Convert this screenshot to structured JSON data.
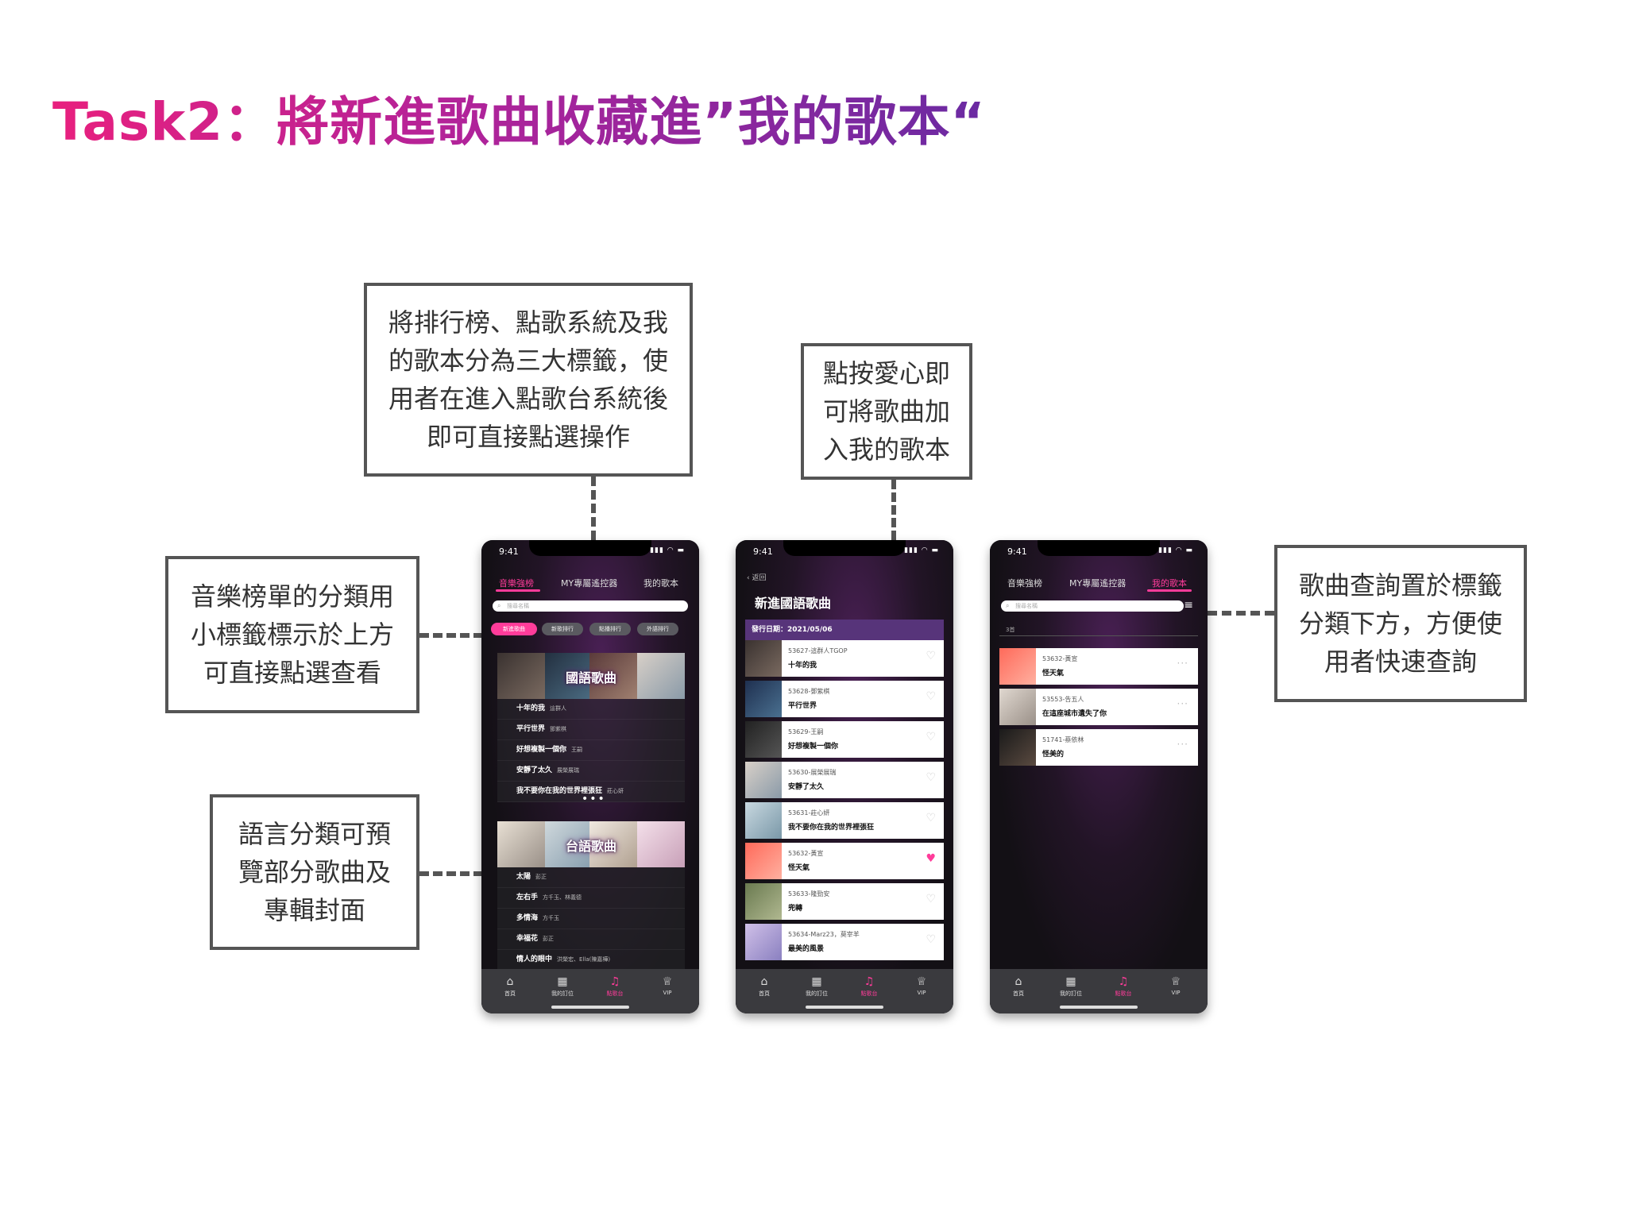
{
  "title": "Task2：將新進歌曲收藏進”我的歌本“",
  "callouts": {
    "tabs": [
      "將排行榜、點歌系統及我",
      "的歌本分為三大標籤，使",
      "用者在進入點歌台系統後",
      "即可直接點選操作"
    ],
    "heart": [
      "點按愛心即",
      "可將歌曲加",
      "入我的歌本"
    ],
    "chips": [
      "音樂榜單的分類用",
      "小標籤標示於上方",
      "可直接點選查看"
    ],
    "language": [
      "語言分類可預",
      "覽部分歌曲及",
      "專輯封面"
    ],
    "search": [
      "歌曲查詢置於標籤",
      "分類下方，方便使",
      "用者快速查詢"
    ]
  },
  "status": {
    "time": "9:41",
    "icons": "▮▮▮ ◠ ▬"
  },
  "tabs": [
    "音樂強榜",
    "MY專屬遙控器",
    "我的歌本"
  ],
  "search_placeholder": "搜尋名稱",
  "chips": [
    "新進歌曲",
    "新歌排行",
    "點播排行",
    "外語排行"
  ],
  "categories": [
    {
      "label": "國語歌曲",
      "songs": [
        {
          "title": "十年的我",
          "artist": "這群人"
        },
        {
          "title": "平行世界",
          "artist": "鄧紫棋"
        },
        {
          "title": "好想複製一個你",
          "artist": "王嗣"
        },
        {
          "title": "安靜了太久",
          "artist": "展榮展瑞"
        },
        {
          "title": "我不要你在我的世界裡張狂",
          "artist": "莊心妍"
        }
      ]
    },
    {
      "label": "台語歌曲",
      "songs": [
        {
          "title": "太陽",
          "artist": "彭正"
        },
        {
          "title": "左右手",
          "artist": "方千玉、林義德"
        },
        {
          "title": "多情海",
          "artist": "方千玉"
        },
        {
          "title": "幸福花",
          "artist": "彭正"
        },
        {
          "title": "情人的眼中",
          "artist": "洪榮宏、Ella(陳嘉樺)"
        }
      ]
    }
  ],
  "more": "•••",
  "tabbar": [
    {
      "label": "首頁",
      "icon": "home-icon"
    },
    {
      "label": "我的訂位",
      "icon": "calendar-icon"
    },
    {
      "label": "點歌台",
      "icon": "music-icon"
    },
    {
      "label": "VIP",
      "icon": "crown-icon"
    }
  ],
  "new_songs": {
    "back": "‹ 返回",
    "title": "新進國語歌曲",
    "date": "發行日期：2021/05/06",
    "items": [
      {
        "sub": "53627-這群人TGOP",
        "name": "十年的我",
        "fav": false
      },
      {
        "sub": "53628-鄧紫棋",
        "name": "平行世界",
        "fav": false
      },
      {
        "sub": "53629-王嗣",
        "name": "好想複製一個你",
        "fav": false
      },
      {
        "sub": "53630-展榮展瑞",
        "name": "安靜了太久",
        "fav": false
      },
      {
        "sub": "53631-莊心妍",
        "name": "我不要你在我的世界裡張狂",
        "fav": false
      },
      {
        "sub": "53632-黃宣",
        "name": "怪天氣",
        "fav": true
      },
      {
        "sub": "53633-隆勁安",
        "name": "兜轉",
        "fav": false
      },
      {
        "sub": "53634-Marz23，莫宰羊",
        "name": "最美的風景",
        "fav": false
      }
    ]
  },
  "my_songbook": {
    "count": "3首",
    "items": [
      {
        "sub": "53632-黃宣",
        "name": "怪天氣"
      },
      {
        "sub": "53553-告五人",
        "name": "在這座城市遺失了你"
      },
      {
        "sub": "51741-蔡依林",
        "name": "怪美的"
      }
    ]
  },
  "colors": {
    "accent": "#ff3c9a",
    "date_bar": "#57347a",
    "title_start": "#e8207e",
    "title_end": "#6a2aa2"
  }
}
